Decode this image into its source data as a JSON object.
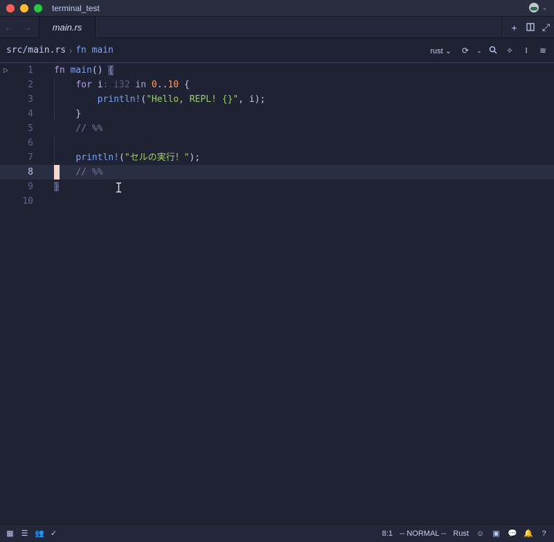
{
  "window": {
    "title": "terminal_test"
  },
  "tabs": [
    {
      "label": "main.rs",
      "active": true
    }
  ],
  "breadcrumb": {
    "path": "src/main.rs",
    "separator": "›",
    "symbol": "fn main"
  },
  "toolbar": {
    "language": "rust"
  },
  "editor": {
    "line_numbers": [
      "1",
      "2",
      "3",
      "4",
      "5",
      "6",
      "7",
      "8",
      "9",
      "10"
    ],
    "current_line": 8,
    "lines": {
      "l1": {
        "kw": "fn",
        "name": "main",
        "rest": "() ",
        "brace": "{"
      },
      "l2": {
        "kw_for": "for",
        "var": "i",
        "hint": ": i32",
        "kw_in": "in",
        "start": "0",
        "range": "..",
        "end": "10",
        "brace": "{"
      },
      "l3": {
        "macro": "println!",
        "open": "(",
        "str": "\"Hello, REPL! {}\"",
        "rest": ", i);"
      },
      "l4": {
        "brace": "}"
      },
      "l5": {
        "comment": "// %%"
      },
      "l7": {
        "macro": "println!",
        "open": "(",
        "str": "\"セルの実行！\"",
        "rest": ");"
      },
      "l8": {
        "comment": "// %%"
      },
      "l9": {
        "brace": "}"
      }
    }
  },
  "statusbar": {
    "position": "8:1",
    "mode": "-- NORMAL --",
    "language": "Rust"
  },
  "colors": {
    "background": "#1f2232",
    "keyword": "#bb9af7",
    "function": "#7aa2f7",
    "string": "#9ece6a",
    "number": "#ff9e64",
    "comment": "#6f789e",
    "cursor": "#f5d7d0"
  }
}
